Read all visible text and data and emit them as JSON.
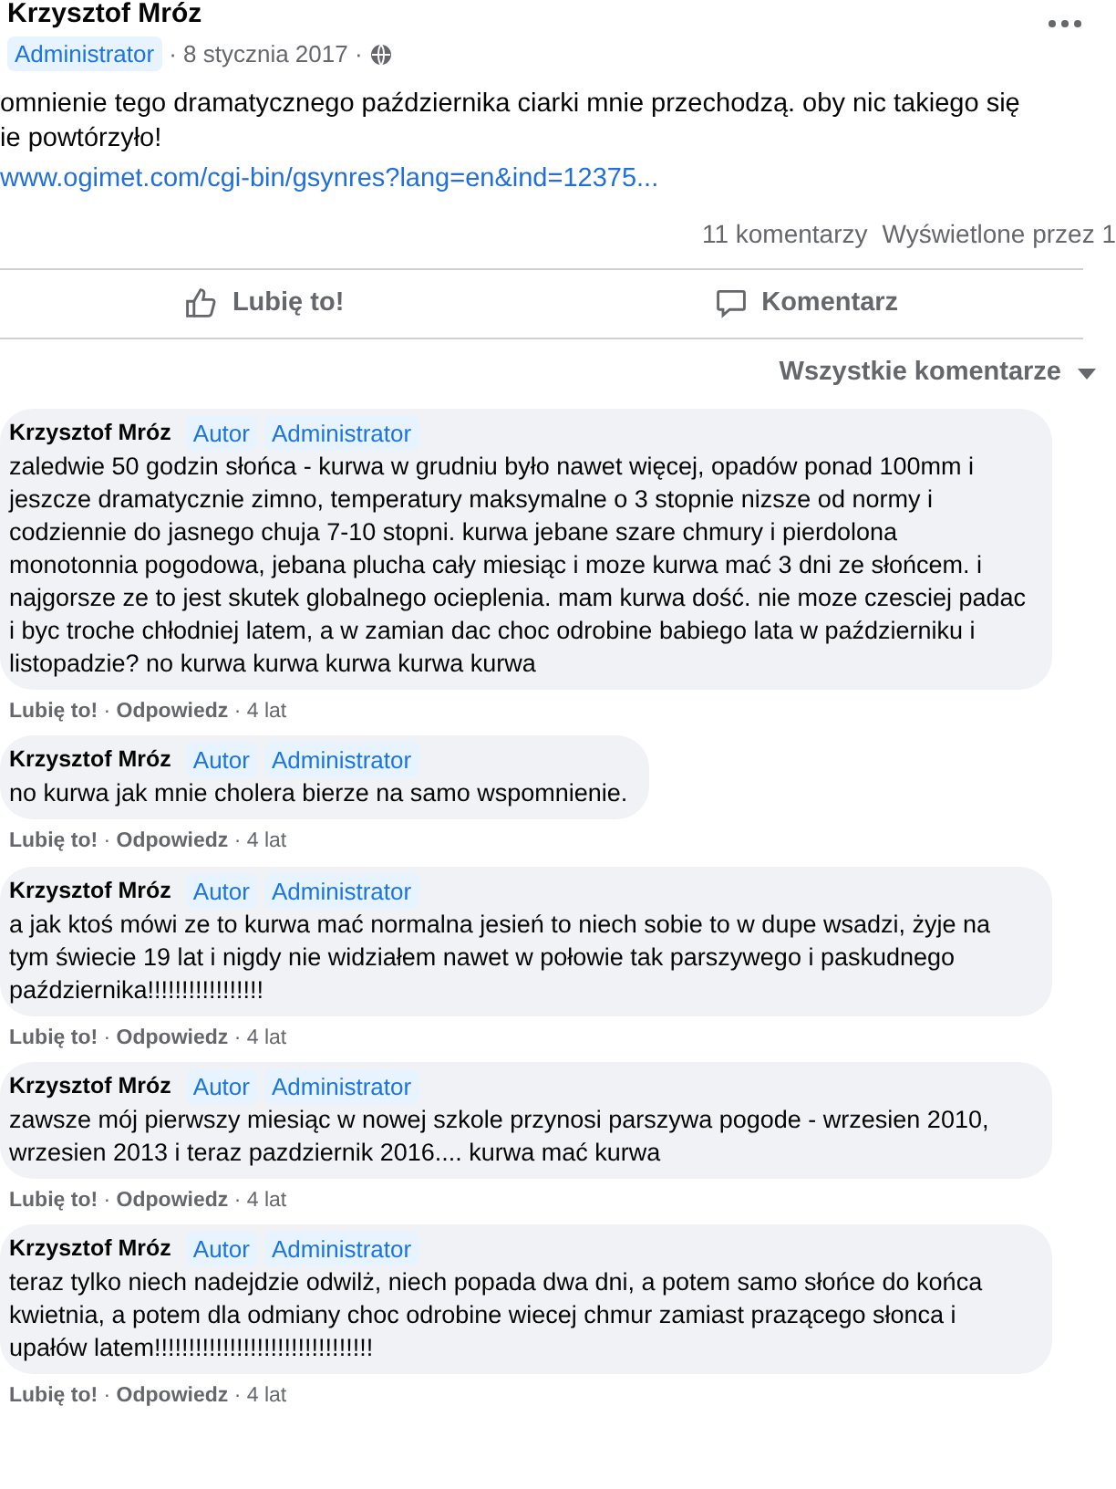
{
  "post": {
    "author": "Krzysztof Mróz",
    "badge": "Administrator",
    "date": "· 8 stycznia 2017 ·",
    "text_lines": [
      "omnienie tego dramatycznego października ciarki mnie przechodzą. oby nic takiego się",
      "ie powtórzyło!"
    ],
    "link": "www.ogimet.com/cgi-bin/gsynres?lang=en&ind=12375...",
    "comment_count": "11 komentarzy",
    "views": "Wyświetlone przez 1"
  },
  "actions": [
    {
      "kind": "like",
      "label": "Lubię to!"
    },
    {
      "kind": "comment",
      "label": "Komentarz"
    }
  ],
  "filter": "Wszystkie komentarze",
  "separator": "·",
  "comments": [
    {
      "author": "Krzysztof Mróz",
      "badges": [
        "Autor",
        "Administrator"
      ],
      "text": "zaledwie 50 godzin słońca - kurwa w grudniu było nawet więcej, opadów ponad 100mm i jeszcze dramatycznie zimno, temperatury maksymalne o 3 stopnie nizsze od normy i codziennie do jasnego chuja 7-10 stopni. kurwa jebane szare chmury i pierdolona monotonnia pogodowa, jebana plucha cały miesiąc i moze kurwa mać 3 dni ze słońcem. i najgorsze ze to jest skutek globalnego ocieplenia. mam kurwa dość. nie moze czesciej padac i byc troche chłodniej latem, a w zamian dac choc odrobine babiego lata w październiku i listopadzie? no kurwa kurwa kurwa kurwa kurwa",
      "like": "Lubię to!",
      "reply": "Odpowiedz",
      "time": "· 4 lat"
    },
    {
      "author": "Krzysztof Mróz",
      "badges": [
        "Autor",
        "Administrator"
      ],
      "text": "no kurwa jak mnie cholera bierze na samo wspomnienie.",
      "like": "Lubię to!",
      "reply": "Odpowiedz",
      "time": "· 4 lat"
    },
    {
      "author": "Krzysztof Mróz",
      "badges": [
        "Autor",
        "Administrator"
      ],
      "text": "a jak ktoś mówi ze to kurwa mać normalna jesień to niech sobie to w dupe wsadzi, żyje na tym świecie 19 lat i nigdy nie widziałem nawet w połowie tak parszywego i paskudnego października!!!!!!!!!!!!!!!!!",
      "like": "Lubię to!",
      "reply": "Odpowiedz",
      "time": "· 4 lat"
    },
    {
      "author": "Krzysztof Mróz",
      "badges": [
        "Autor",
        "Administrator"
      ],
      "text": "zawsze mój pierwszy miesiąc w nowej szkole przynosi parszywa pogode - wrzesien 2010, wrzesien 2013 i teraz pazdziernik 2016.... kurwa mać kurwa",
      "like": "Lubię to!",
      "reply": "Odpowiedz",
      "time": "· 4 lat"
    },
    {
      "author": "Krzysztof Mróz",
      "badges": [
        "Autor",
        "Administrator"
      ],
      "text": "teraz tylko niech nadejdzie odwilż, niech popada dwa dni, a potem samo słońce do końca kwietnia, a potem dla odmiany choc odrobine wiecej chmur zamiast prazącego słonca i upałów latem!!!!!!!!!!!!!!!!!!!!!!!!!!!!!!!!",
      "like": "Lubię to!",
      "reply": "Odpowiedz",
      "time": "· 4 lat"
    }
  ]
}
